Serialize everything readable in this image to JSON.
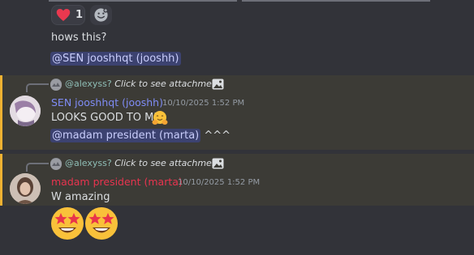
{
  "colors": {
    "background": "#323339",
    "highlight_bg": "#3c3b36",
    "highlight_bar": "#f0b232",
    "mention_bg": "#3c4270",
    "mention_fg": "#c9cdfb",
    "user_sen": "#7f8cf5",
    "user_marta": "#e8344f"
  },
  "reactions": {
    "heart_count": "1"
  },
  "messages": [
    {
      "text": "hows this?"
    },
    {
      "mention": "@SEN jooshhqt (jooshh)"
    },
    {
      "reply": {
        "name": "@alexyss?",
        "text": "Click to see attachment"
      },
      "author": "SEN jooshhqt (jooshh)",
      "timestamp": "10/10/2025 1:52 PM",
      "text": "LOOKS GOOD TO ME",
      "emoji": "hugging-face"
    },
    {
      "mention": "@madam president (marta)",
      "suffix": "^^^"
    },
    {
      "reply": {
        "name": "@alexyss?",
        "text": "Click to see attachment"
      },
      "author": "madam president (marta)",
      "timestamp": "10/10/2025 1:52 PM",
      "text": "W amazing",
      "emoji": "star-struck"
    }
  ]
}
